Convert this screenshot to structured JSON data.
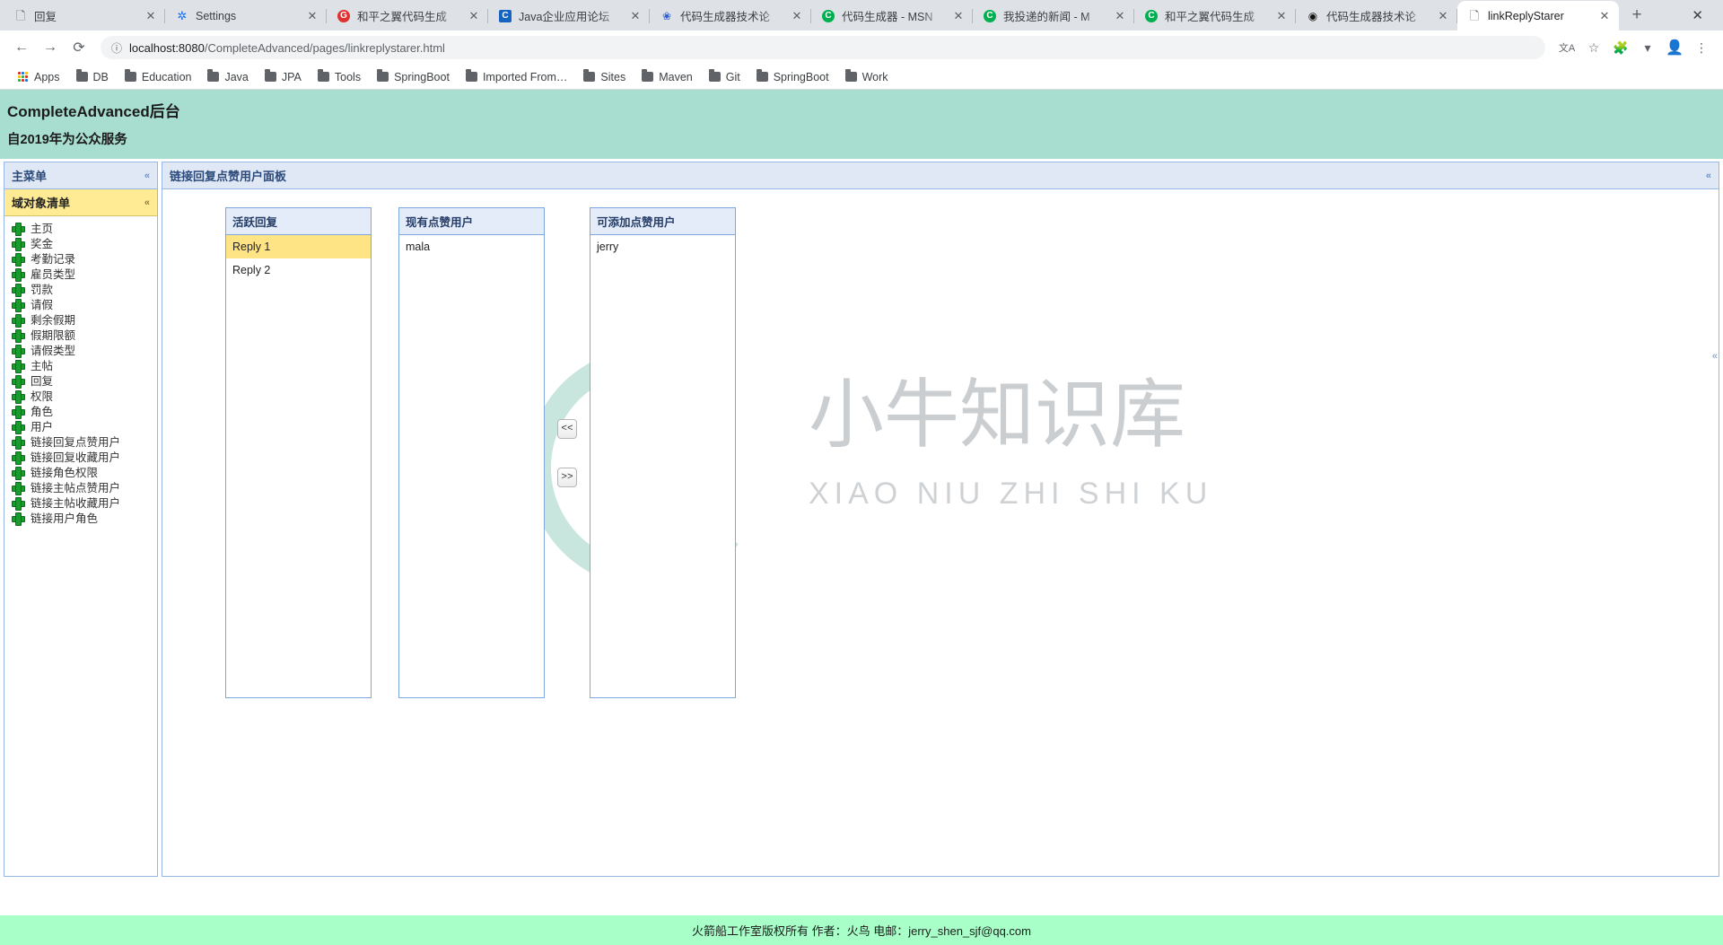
{
  "browser": {
    "tabs": [
      {
        "title": "回复",
        "favicon": "doc-icon",
        "favicon_kind": "doc",
        "active": false
      },
      {
        "title": "Settings",
        "favicon": "gear-icon",
        "favicon_kind": "gear",
        "active": false
      },
      {
        "title": "和平之翼代码生成",
        "favicon": "g-icon",
        "favicon_kind": "g",
        "favicon_text": "G",
        "active": false
      },
      {
        "title": "Java企业应用论坛",
        "favicon": "forum-icon",
        "favicon_kind": "blue",
        "favicon_text": "C",
        "active": false
      },
      {
        "title": "代码生成器技术论",
        "favicon": "baidu-icon",
        "favicon_kind": "paw",
        "favicon_text": "🐾",
        "active": false
      },
      {
        "title": "代码生成器 - MSN",
        "favicon": "csdn-icon",
        "favicon_kind": "c",
        "favicon_text": "C",
        "active": false
      },
      {
        "title": "我投递的新闻 - M",
        "favicon": "csdn-icon",
        "favicon_kind": "c",
        "favicon_text": "C",
        "active": false
      },
      {
        "title": "和平之翼代码生成",
        "favicon": "csdn-icon",
        "favicon_kind": "c",
        "favicon_text": "C",
        "active": false
      },
      {
        "title": "代码生成器技术论",
        "favicon": "moneybag-icon",
        "favicon_kind": "money",
        "favicon_text": "💰",
        "active": false
      },
      {
        "title": "linkReplyStarer",
        "favicon": "doc-icon",
        "favicon_kind": "doc",
        "active": true
      }
    ],
    "tab_close_label": "✕",
    "newtab_label": "+",
    "window_close_label": "✕",
    "nav": {
      "back": "←",
      "forward": "→",
      "reload": "⟳"
    },
    "omnibox": {
      "info_icon": "ⓘ",
      "host": "localhost:8080",
      "path": "/CompleteAdvanced/pages/linkreplystarer.html"
    },
    "toolbar_icons": {
      "translate": "文A",
      "bookmark_star": "☆",
      "extension": "🧩",
      "chevron": "▾",
      "profile": "👤",
      "menu": "⋮"
    },
    "bookmarks": {
      "apps_label": "Apps",
      "items": [
        "DB",
        "Education",
        "Java",
        "JPA",
        "Tools",
        "SpringBoot",
        "Imported From…",
        "Sites",
        "Maven",
        "Git",
        "SpringBoot",
        "Work"
      ]
    }
  },
  "app": {
    "title": "CompleteAdvanced后台",
    "subtitle": "自2019年为公众服务"
  },
  "sidebar": {
    "header": "主菜单",
    "collapse_icon": "«",
    "group_title": "域对象清单",
    "group_collapse_icon": "«",
    "items": [
      "主页",
      "奖金",
      "考勤记录",
      "雇员类型",
      "罚款",
      "请假",
      "剩余假期",
      "假期限额",
      "请假类型",
      "主帖",
      "回复",
      "权限",
      "角色",
      "用户",
      "链接回复点赞用户",
      "链接回复收藏用户",
      "链接角色权限",
      "链接主帖点赞用户",
      "链接主帖收藏用户",
      "链接用户角色"
    ]
  },
  "content": {
    "header": "链接回复点赞用户面板",
    "collapse_icon": "«",
    "columns": [
      {
        "name": "active-replies-column",
        "header": "活跃回复",
        "rows": [
          {
            "label": "Reply 1",
            "selected": true
          },
          {
            "label": "Reply 2",
            "selected": false
          }
        ]
      },
      {
        "name": "current-star-users-column",
        "header": "现有点赞用户",
        "rows": [
          {
            "label": "mala",
            "selected": false
          }
        ]
      },
      {
        "name": "available-star-users-column",
        "header": "可添加点赞用户",
        "rows": [
          {
            "label": "jerry",
            "selected": false
          }
        ]
      }
    ],
    "buttons": {
      "move_left": "<<",
      "move_right": ">>"
    },
    "watermark": {
      "cn_text": "小牛知识库",
      "pinyin_text": "XIAO NIU ZHI SHI KU"
    }
  },
  "footer": {
    "text": "火箭船工作室版权所有 作者：火鸟 电邮：jerry_shen_sjf@qq.com"
  },
  "colors": {
    "app_header_bg": "#a8ded0",
    "footer_bg": "#a8ffc8",
    "panel_header_bg": "#e0e8f6",
    "group_bg": "#ffeb94",
    "selected_row_bg": "#ffe486",
    "border": "#95b8e7"
  }
}
